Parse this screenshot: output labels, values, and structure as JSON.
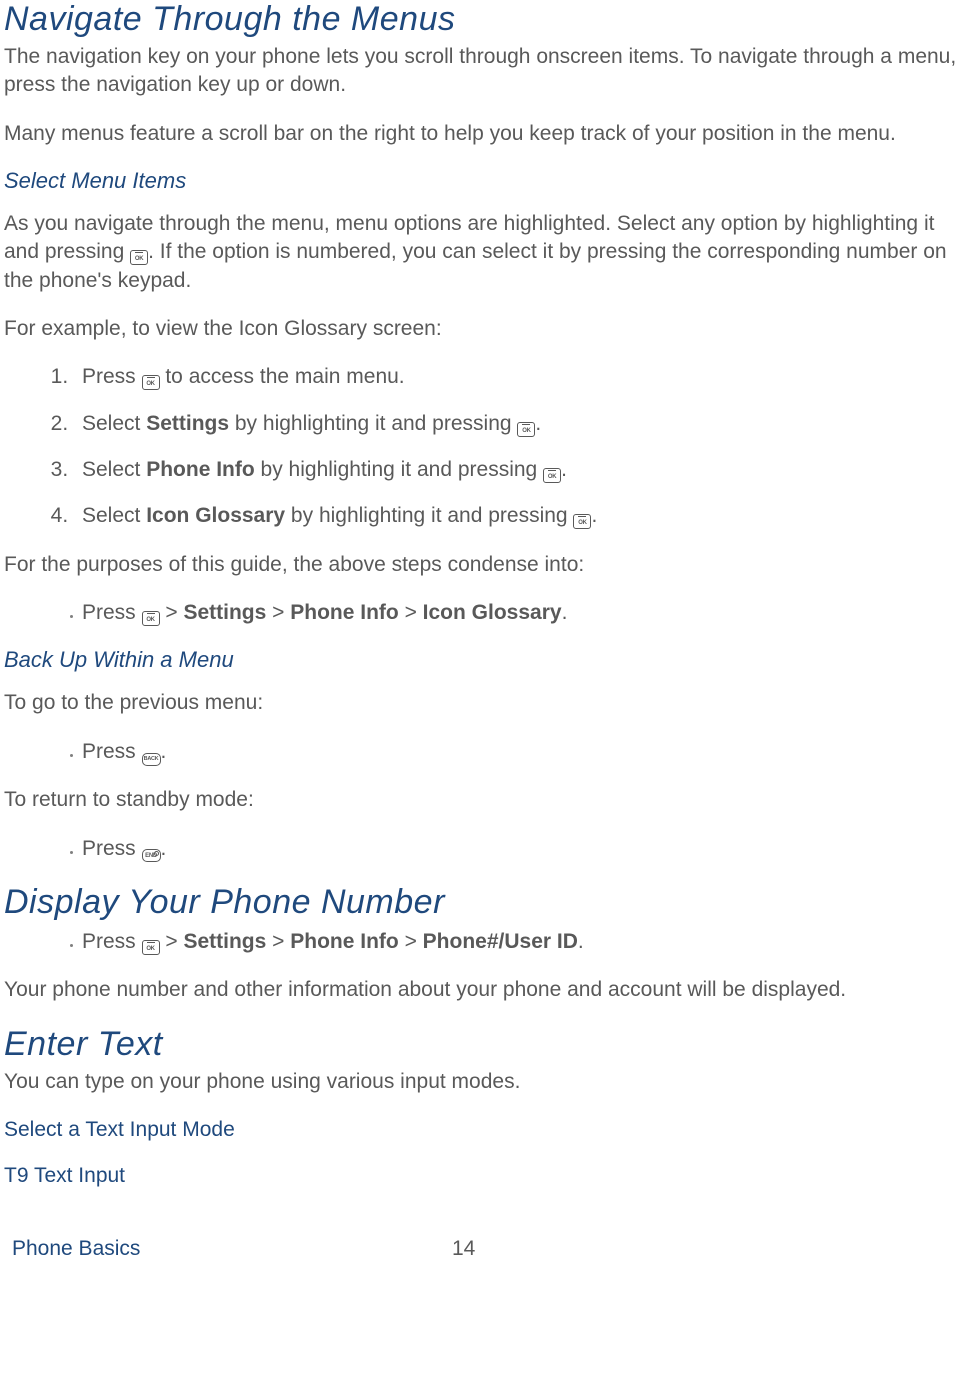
{
  "h1_navigate": "Navigate Through the Menus",
  "p1": "The navigation key on your phone lets you scroll through onscreen items. To navigate through a menu, press the navigation key up or down.",
  "p2": "Many menus feature a scroll bar on the right to help you keep track of your position in the menu.",
  "h2_select": "Select Menu Items",
  "p3a": "As you navigate through the menu, menu options are highlighted. Select any option by highlighting it and pressing ",
  "p3b": ". If the option is numbered, you can select it by pressing the corresponding number on the phone's keypad.",
  "p4": "For example, to view the Icon Glossary screen:",
  "ol": {
    "i1a": "Press ",
    "i1b": " to access the main menu.",
    "i2a": "Select ",
    "i2b": "Settings",
    "i2c": " by highlighting it and pressing ",
    "i3a": "Select ",
    "i3b": "Phone Info",
    "i3c": " by highlighting it and pressing ",
    "i4a": "Select ",
    "i4b": "Icon Glossary",
    "i4c": " by highlighting it and pressing "
  },
  "p5": "For the purposes of this guide, the above steps condense into:",
  "cond": {
    "a": "Press ",
    "gt": " > ",
    "s": "Settings",
    "pi": "Phone Info",
    "ig": "Icon Glossary"
  },
  "h2_back": "Back Up Within a Menu",
  "p6": "To go to the previous menu:",
  "press": "Press ",
  "p7": "To return to standby mode:",
  "h1_display": "Display Your Phone Number",
  "disp": {
    "a": "Press ",
    "gt": " > ",
    "s": "Settings",
    "pi": "Phone Info",
    "pu": "Phone#/User ID"
  },
  "p8": "Your phone number and other information about your phone and account will be displayed.",
  "h1_enter": "Enter Text",
  "p9": "You can type on your phone using various input modes.",
  "link1": "Select a Text Input Mode",
  "link2": "T9 Text Input",
  "footer_section": "Phone Basics",
  "footer_page": "14",
  "icon_ok_label": "OK",
  "icon_back_label": "BACK",
  "icon_end_label": "END"
}
